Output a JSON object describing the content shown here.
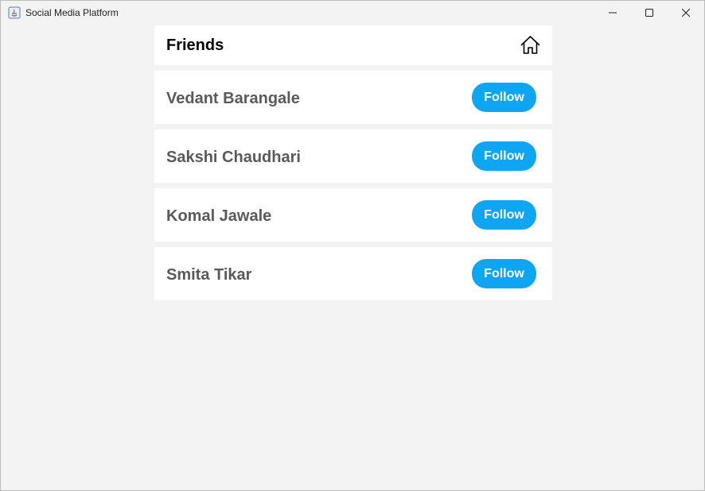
{
  "window": {
    "title": "Social Media Platform"
  },
  "header": {
    "title": "Friends",
    "home_icon": "home-icon"
  },
  "friends": [
    {
      "name": "Vedant Barangale",
      "action_label": "Follow"
    },
    {
      "name": "Sakshi Chaudhari",
      "action_label": "Follow"
    },
    {
      "name": "Komal Jawale",
      "action_label": "Follow"
    },
    {
      "name": "Smita Tikar",
      "action_label": "Follow"
    }
  ],
  "colors": {
    "follow_button": "#0ea5f2",
    "name_text": "#5a5a5a",
    "background": "#f3f3f3"
  }
}
